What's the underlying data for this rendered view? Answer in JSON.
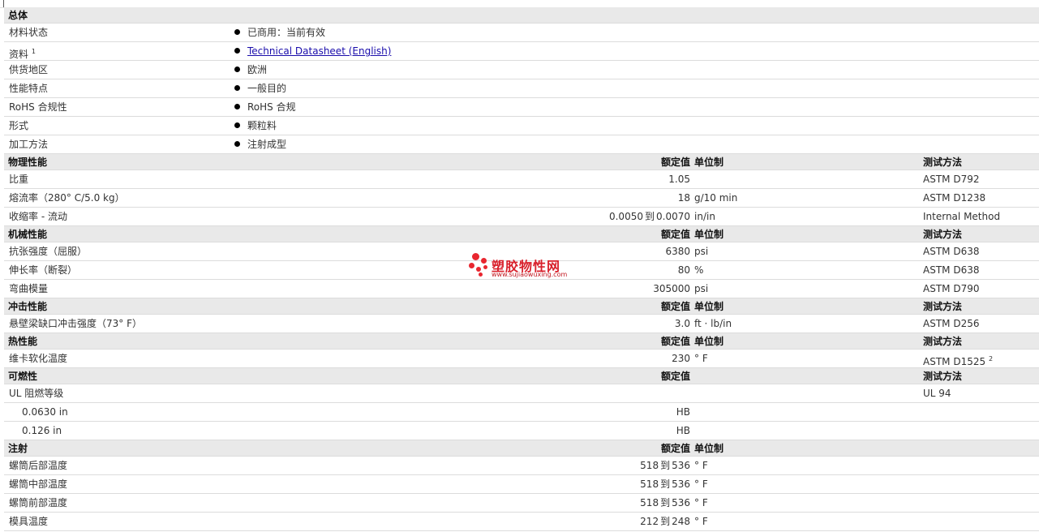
{
  "general": {
    "title": "总体",
    "rows": [
      {
        "label": "材料状态",
        "value": "已商用：当前有效"
      },
      {
        "label": "资料",
        "label_sup": "1",
        "value": "Technical Datasheet (English)",
        "is_link": true
      },
      {
        "label": "供货地区",
        "value": "欧洲"
      },
      {
        "label": "性能特点",
        "value": "一般目的"
      },
      {
        "label": "RoHS 合规性",
        "value": "RoHS 合规"
      },
      {
        "label": "形式",
        "value": "颗粒料"
      },
      {
        "label": "加工方法",
        "value": "注射成型"
      }
    ]
  },
  "sections": [
    {
      "title": "物理性能",
      "h_value": "额定值",
      "h_unit": "单位制",
      "h_method": "测试方法",
      "rows": [
        {
          "label": "比重",
          "value": "1.05",
          "unit": "",
          "method": "ASTM D792"
        },
        {
          "label": "熔流率（280° C/5.0 kg）",
          "value": "18",
          "unit": "g/10 min",
          "method": "ASTM D1238"
        },
        {
          "label": "收缩率 - 流动",
          "value_from": "0.0050",
          "to": "到",
          "value_to": "0.0070",
          "unit": "in/in",
          "method": "Internal Method"
        }
      ]
    },
    {
      "title": "机械性能",
      "h_value": "额定值",
      "h_unit": "单位制",
      "h_method": "测试方法",
      "rows": [
        {
          "label": "抗张强度（屈服）",
          "value": "6380",
          "unit": "psi",
          "method": "ASTM D638"
        },
        {
          "label": "伸长率（断裂）",
          "value": "80",
          "unit": "%",
          "method": "ASTM D638"
        },
        {
          "label": "弯曲模量",
          "value": "305000",
          "unit": "psi",
          "method": "ASTM D790"
        }
      ]
    },
    {
      "title": "冲击性能",
      "h_value": "额定值",
      "h_unit": "单位制",
      "h_method": "测试方法",
      "rows": [
        {
          "label": "悬壁梁缺口冲击强度（73° F）",
          "value": "3.0",
          "unit": "ft · lb/in",
          "method": "ASTM D256"
        }
      ]
    },
    {
      "title": "热性能",
      "h_value": "额定值",
      "h_unit": "单位制",
      "h_method": "测试方法",
      "rows": [
        {
          "label": "维卡软化温度",
          "value": "230",
          "unit": "° F",
          "method": "ASTM D1525",
          "method_sup": "2"
        }
      ]
    },
    {
      "title": "可燃性",
      "h_value": "额定值",
      "h_unit": "",
      "h_method": "测试方法",
      "rows": [
        {
          "label": "UL 阻燃等级",
          "value": "",
          "unit": "",
          "method": "UL 94"
        },
        {
          "label": "0.0630 in",
          "indent": true,
          "value": "HB",
          "unit": "",
          "method": ""
        },
        {
          "label": "0.126 in",
          "indent": true,
          "value": "HB",
          "unit": "",
          "method": ""
        }
      ]
    },
    {
      "title": "注射",
      "h_value": "额定值",
      "h_unit": "单位制",
      "h_method": "",
      "rows": [
        {
          "label": "螺筒后部温度",
          "value_from": "518",
          "to": "到",
          "value_to": "536",
          "unit": "° F",
          "method": ""
        },
        {
          "label": "螺筒中部温度",
          "value_from": "518",
          "to": "到",
          "value_to": "536",
          "unit": "° F",
          "method": ""
        },
        {
          "label": "螺筒前部温度",
          "value_from": "518",
          "to": "到",
          "value_to": "536",
          "unit": "° F",
          "method": ""
        },
        {
          "label": "模具温度",
          "value_from": "212",
          "to": "到",
          "value_to": "248",
          "unit": "° F",
          "method": ""
        }
      ]
    }
  ],
  "watermark": {
    "title": "塑胶物性网",
    "url": "www.sujiaowuxing.com",
    "color": "#e8262f"
  }
}
